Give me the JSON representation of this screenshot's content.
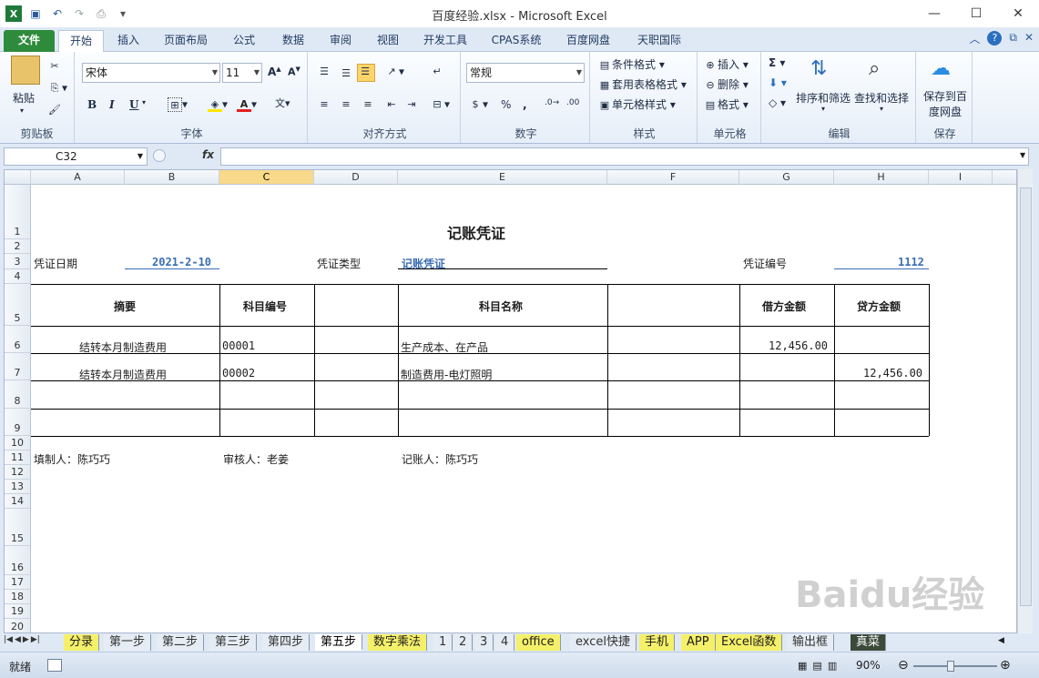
{
  "window": {
    "title": "百度经验.xlsx  -  Microsoft Excel"
  },
  "ribbon_tabs": [
    "文件",
    "开始",
    "插入",
    "页面布局",
    "公式",
    "数据",
    "审阅",
    "视图",
    "开发工具",
    "CPAS系统",
    "百度网盘",
    "天职国际"
  ],
  "ribbon": {
    "paste_label": "粘贴",
    "clipboard_label": "剪贴板",
    "font_name": "宋体",
    "font_size": "11",
    "font_label": "字体",
    "align_label": "对齐方式",
    "number_format": "常规",
    "number_label": "数字",
    "cond_format": "条件格式",
    "table_format": "套用表格格式",
    "cell_style": "单元格样式",
    "style_label": "样式",
    "insert": "插入",
    "delete": "删除",
    "format": "格式",
    "cells_label": "单元格",
    "sort_filter": "排序和筛选",
    "find_select": "查找和选择",
    "edit_label": "编辑",
    "save_to_pan_1": "保存到百",
    "save_to_pan_2": "度网盘",
    "save_label": "保存",
    "bold": "B",
    "italic": "I",
    "underline": "U",
    "percent": "%",
    "comma": ","
  },
  "formula_bar": {
    "name_box": "C32",
    "fx": "fx",
    "formula": ""
  },
  "columns": [
    "A",
    "B",
    "C",
    "D",
    "E",
    "F",
    "G",
    "H",
    "I"
  ],
  "selected_column": "C",
  "rows": [
    "1",
    "2",
    "3",
    "4",
    "5",
    "6",
    "7",
    "8",
    "9",
    "10",
    "11",
    "12",
    "13",
    "14",
    "15",
    "16",
    "17",
    "18",
    "19",
    "20"
  ],
  "voucher": {
    "title": "记账凭证",
    "date_label": "凭证日期",
    "date_value": "2021-2-10",
    "type_label": "凭证类型",
    "type_value": "记账凭证",
    "number_label": "凭证编号",
    "number_value": "1112",
    "headers": {
      "summary": "摘要",
      "account_code": "科目编号",
      "account_name": "科目名称",
      "debit": "借方金额",
      "credit": "贷方金额"
    },
    "lines": [
      {
        "summary": "结转本月制造费用",
        "code": "00001",
        "name": "生产成本、在产品",
        "debit": "12,456.00",
        "credit": ""
      },
      {
        "summary": "结转本月制造费用",
        "code": "00002",
        "name": "制造费用-电灯照明",
        "debit": "",
        "credit": "12,456.00"
      }
    ],
    "preparer": "填制人：陈巧巧",
    "reviewer": "审核人：老姜",
    "bookkeeper": "记账人：陈巧巧"
  },
  "sheet_tabs": [
    "分录",
    "第一步",
    "第二步",
    "第三步",
    "第四步",
    "第五步",
    "数字乘法",
    "1",
    "2",
    "3",
    "4",
    "office",
    "excel快捷",
    "手机",
    "APP",
    "Excel函数",
    "输出框",
    "真菜"
  ],
  "active_sheet": "第五步",
  "status": {
    "ready": "就绪",
    "zoom": "90%"
  },
  "watermark": "Baidu经验",
  "colors": {
    "file_tab": "#2e8b3c",
    "blue_text": "#3a6db5",
    "sheet_tab_yellow": "#f5f06a"
  }
}
